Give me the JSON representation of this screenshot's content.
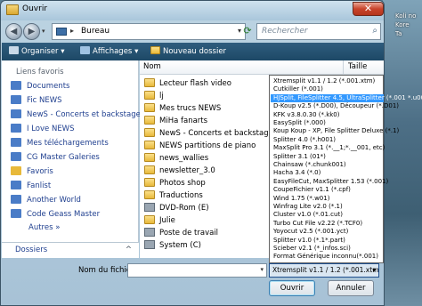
{
  "window": {
    "title": "Ouvrir",
    "close_glyph": "✕"
  },
  "desktop": {
    "labels": [
      "Koli no",
      "Kore",
      "Ta"
    ]
  },
  "nav": {
    "back_glyph": "◀",
    "forward_glyph": "▶",
    "dropdown_glyph": "▾",
    "refresh_glyph": "⟳"
  },
  "address": {
    "path": "Bureau",
    "separator": "▸",
    "dropdown_glyph": "▾"
  },
  "search": {
    "placeholder": "Rechercher",
    "icon_glyph": "⌕"
  },
  "toolbar": {
    "organize_label": "Organiser",
    "views_label": "Affichages",
    "new_folder_label": "Nouveau dossier",
    "dropdown_glyph": "▾"
  },
  "sidebar": {
    "section_favorites": "Liens favoris",
    "items": [
      {
        "label": "Documents",
        "icon": "documents-folder-icon",
        "color": "#4a7cc7"
      },
      {
        "label": "Fic NEWS",
        "icon": "folder-link-icon",
        "color": "#4a7cc7"
      },
      {
        "label": "NewS - Concerts et backstages",
        "icon": "folder-link-icon",
        "color": "#4a7cc7"
      },
      {
        "label": "I Love NEWS",
        "icon": "folder-link-icon",
        "color": "#4a7cc7"
      },
      {
        "label": "Mes téléchargements",
        "icon": "download-folder-icon",
        "color": "#4a7cc7"
      },
      {
        "label": "CG Master Galeries",
        "icon": "folder-link-icon",
        "color": "#4a7cc7"
      },
      {
        "label": "Favoris",
        "icon": "star-icon",
        "color": "#e8b93a"
      },
      {
        "label": "Fanlist",
        "icon": "folder-link-icon",
        "color": "#4a7cc7"
      },
      {
        "label": "Another World",
        "icon": "folder-link-icon",
        "color": "#4a7cc7"
      },
      {
        "label": "Code Geass Master",
        "icon": "folder-link-icon",
        "color": "#4a7cc7"
      }
    ],
    "more_label": "Autres",
    "more_glyph": "»",
    "folders_label": "Dossiers",
    "folders_glyph": "^"
  },
  "filelist": {
    "col_name": "Nom",
    "col_size": "Taille",
    "items": [
      {
        "label": "Lecteur flash video",
        "icon": "folder-icon"
      },
      {
        "label": "lj",
        "icon": "folder-icon"
      },
      {
        "label": "Mes trucs NEWS",
        "icon": "folder-icon"
      },
      {
        "label": "MiHa fanarts",
        "icon": "folder-icon"
      },
      {
        "label": "NewS - Concerts et backstages",
        "icon": "folder-icon"
      },
      {
        "label": "NEWS partitions de piano",
        "icon": "folder-icon"
      },
      {
        "label": "news_wallies",
        "icon": "folder-icon"
      },
      {
        "label": "newsletter_3.0",
        "icon": "folder-icon"
      },
      {
        "label": "Photos shop",
        "icon": "folder-icon"
      },
      {
        "label": "Traductions",
        "icon": "folder-icon"
      },
      {
        "label": "DVD-Rom (E)",
        "icon": "dvd-drive-icon"
      },
      {
        "label": "Julie",
        "icon": "user-folder-icon"
      },
      {
        "label": "Poste de travail",
        "icon": "computer-icon"
      },
      {
        "label": "System (C)",
        "icon": "hard-drive-icon"
      }
    ]
  },
  "filetypes": {
    "selected_index": 2,
    "options": [
      "Xtremsplit v1.1 / 1.2 (*.001.xtm)",
      "Cutkiller (*.001)",
      "HJSplit, FileSplitter 4.5, UltraSplitter (*.001 *.u001)",
      "D-Koup v2.5 (*.D00), Découpeur (*.D01)",
      "KFK v3.8.0.30 (*.kk0)",
      "EasySplit (*.000)",
      "Koup Koup - XP, File Splitter Deluxe (*.1)",
      "Splitter 4.0 (*.h001)",
      "MaxSplit Pro 3.1 (*.__1;*.__001, etc)",
      "Splitter 3.1 (01*)",
      "Chainsaw (*.chunk001)",
      "Hacha 3.4 (*.0)",
      "EasyFileCut, MaxSplitter 1.53 (*.001)",
      "CoupeFichier v1.1 (*.cpf)",
      "Wind 1.75 (*.w01)",
      "Winfrag Lite v2.0 (*.1)",
      "Cluster v1.0 (*.01.cut)",
      "Turbo Cut File v2.22 (*.TCF0)",
      "Yoyocut v2.5 (*.001.yct)",
      "Splitter v1.0 (*.1*.part)",
      "Scieber v2.1 (*_infos.sci)",
      "Format Générique inconnu(*.001)"
    ],
    "current": "Xtremsplit v1.1 / 1.2 (*.001.xtm",
    "dropdown_glyph": "▾"
  },
  "footer": {
    "filename_label": "Nom du fichier :",
    "filename_value": "",
    "filename_dropdown_glyph": "▾",
    "open_label": "Ouvrir",
    "cancel_label": "Annuler"
  }
}
